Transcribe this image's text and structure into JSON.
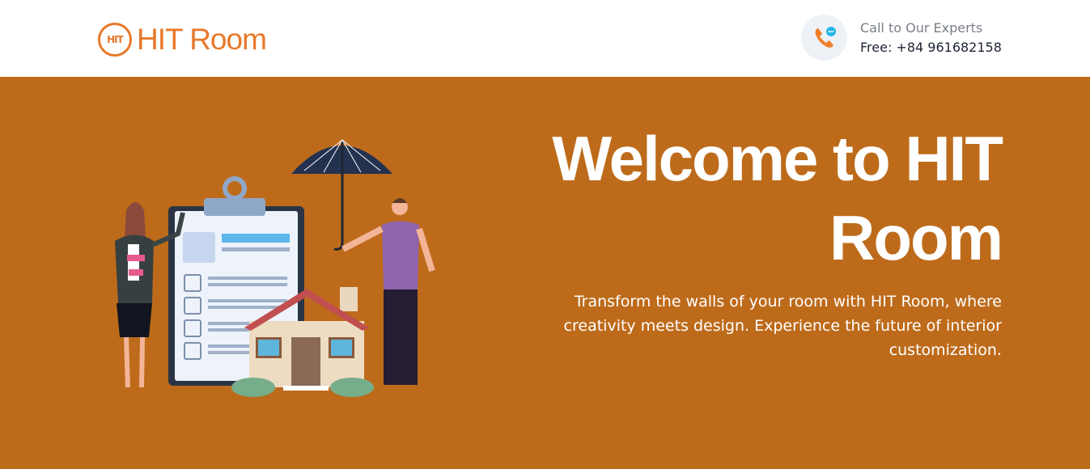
{
  "header": {
    "logo_badge": "HIT",
    "logo_text": "HIT Room",
    "contact_icon": "phone-chat-icon",
    "contact_label": "Call to Our Experts",
    "contact_phone": "Free: +84 961682158"
  },
  "hero": {
    "title": "Welcome to HIT Room",
    "description": "Transform the walls of your room with HIT Room, where creativity meets design. Experience the future of interior customization.",
    "illustration": "real-estate-insurance-illustration"
  },
  "colors": {
    "brand": "#e8792b",
    "hero_bg": "#bd6b1b"
  }
}
